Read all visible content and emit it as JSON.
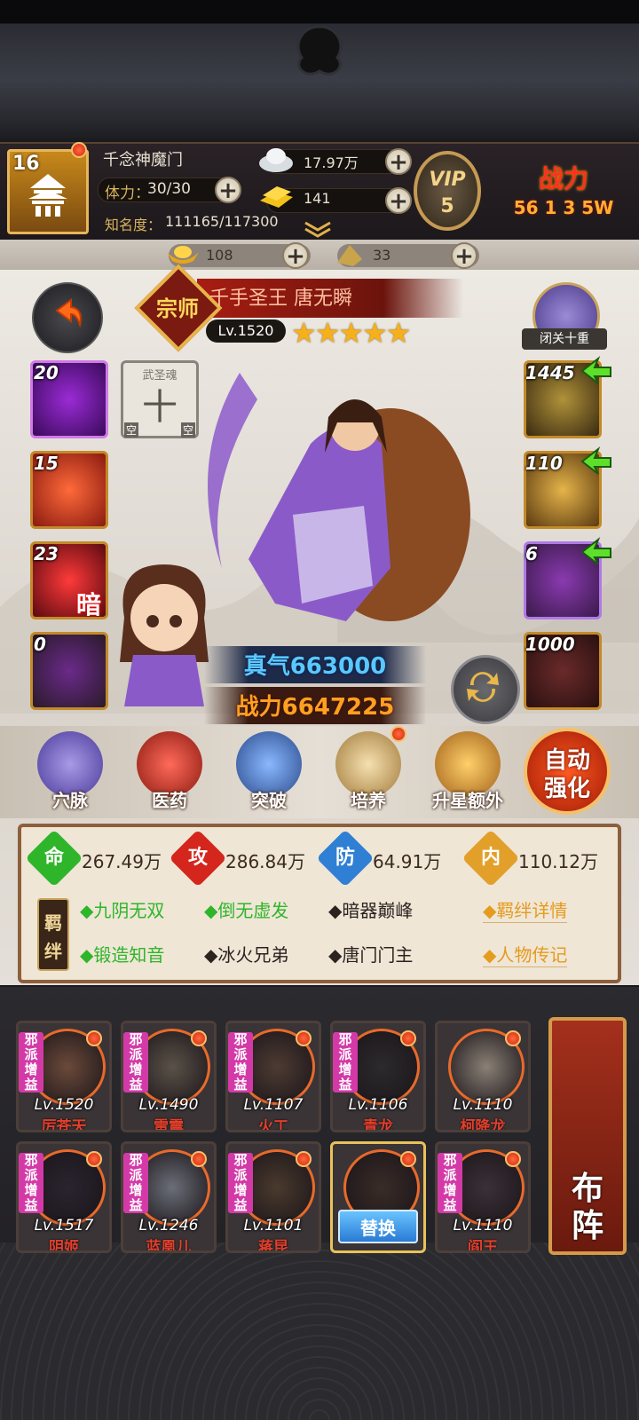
{
  "header": {
    "player_level": "16",
    "sect_name": "千念神魔门",
    "stamina_label": "体力：",
    "stamina_value": "30/30",
    "fame_label": "知名度：",
    "fame_value": "111165/117300",
    "silver": "17.97万",
    "gold": "141",
    "vip_label": "VIP",
    "vip_level": "5",
    "power_label": "战力",
    "power_value": "56 1 3 5W"
  },
  "currency_strip": {
    "ingot": "108",
    "token": "33"
  },
  "hero": {
    "title": "千手圣王 唐无瞬",
    "badge": "宗师",
    "level": "Lv.1520",
    "stars": 5,
    "true_qi": "真气663000",
    "combat_power": "战力6647225",
    "meditation_label": "闭关十重"
  },
  "left_slots": [
    {
      "count": "20"
    },
    {
      "count": "15"
    },
    {
      "count": "23",
      "char": "暗"
    },
    {
      "count": "0"
    }
  ],
  "soul_slot": {
    "title": "武圣魂",
    "char": "十",
    "left": "空",
    "right": "空"
  },
  "right_slots": [
    {
      "count": "1445"
    },
    {
      "count": "110"
    },
    {
      "count": "6"
    },
    {
      "count": "1000"
    }
  ],
  "menu": [
    {
      "label": "穴脉",
      "color": "#7c6cc9"
    },
    {
      "label": "医药",
      "color": "#d33a2a"
    },
    {
      "label": "突破",
      "color": "#5a8fc9"
    },
    {
      "label": "培养",
      "color": "#d9b070"
    },
    {
      "label": "升星额外",
      "color": "#e0a83a"
    }
  ],
  "auto_button": {
    "line1": "自动",
    "line2": "强化"
  },
  "stats": [
    {
      "char": "命",
      "value": "267.49万",
      "color": "#2fb52a"
    },
    {
      "char": "攻",
      "value": "286.84万",
      "color": "#d4261c"
    },
    {
      "char": "防",
      "value": "64.91万",
      "color": "#2f7fd4"
    },
    {
      "char": "内",
      "value": "110.12万",
      "color": "#e2a02a"
    }
  ],
  "bonds": {
    "tag_top": "羁",
    "tag_bottom": "绊",
    "row1": [
      {
        "text": "◆九阴无双",
        "active": true
      },
      {
        "text": "◆倒无虚发",
        "active": true
      },
      {
        "text": "◆暗器巅峰",
        "active": false
      }
    ],
    "row2": [
      {
        "text": "◆锻造知音",
        "active": true
      },
      {
        "text": "◆冰火兄弟",
        "active": false
      },
      {
        "text": "◆唐门门主",
        "active": false
      }
    ],
    "link1": "◆羁绊详情",
    "link2": "◆人物传记"
  },
  "heroes": [
    {
      "level": "Lv.1520",
      "name": "厉苍天",
      "tag": "邪派增益",
      "color": "#6b4a3a"
    },
    {
      "level": "Lv.1490",
      "name": "雷震",
      "tag": "邪派增益",
      "color": "#5a5248"
    },
    {
      "level": "Lv.1107",
      "name": "火工",
      "tag": "邪派增益",
      "color": "#4d3b33"
    },
    {
      "level": "Lv.1106",
      "name": "青龙",
      "tag": "邪派增益",
      "color": "#2c2a2e"
    },
    {
      "level": "Lv.1110",
      "name": "柯降龙",
      "tag": "",
      "color": "#8a8076"
    },
    {
      "level": "Lv.1517",
      "name": "阴姬",
      "tag": "邪派增益",
      "color": "#2a2430"
    },
    {
      "level": "Lv.1246",
      "name": "蓝凰儿",
      "tag": "邪派增益",
      "color": "#6b6e78"
    },
    {
      "level": "Lv.1101",
      "name": "蒋昆",
      "tag": "邪派增益",
      "color": "#4a3a2e"
    },
    {
      "level": "",
      "name": "",
      "tag": "",
      "color": "#3a2c28",
      "replace": "替换"
    },
    {
      "level": "Lv.1110",
      "name": "阎王",
      "tag": "邪派增益",
      "color": "#3a3138"
    }
  ],
  "formation_button": {
    "line1": "布",
    "line2": "阵"
  }
}
